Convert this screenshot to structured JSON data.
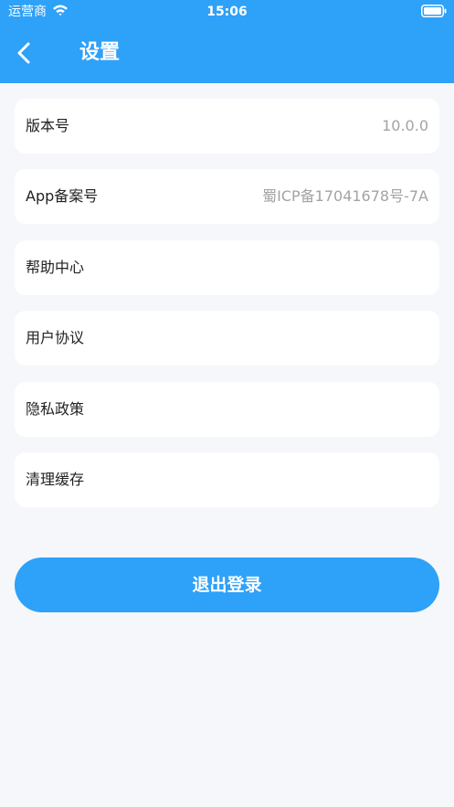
{
  "status_bar": {
    "carrier": "运营商",
    "time": "15:06",
    "wifi_icon": "wifi-icon",
    "battery_icon": "battery-icon"
  },
  "header": {
    "back_icon": "chevron-left-icon",
    "title": "设置",
    "background_color": "#2ea1f8"
  },
  "settings": {
    "items": [
      {
        "label": "版本号",
        "value": "10.0.0"
      },
      {
        "label": "App备案号",
        "value": "蜀ICP备17041678号-7A"
      },
      {
        "label": "帮助中心",
        "value": ""
      },
      {
        "label": "用户协议",
        "value": ""
      },
      {
        "label": "隐私政策",
        "value": ""
      },
      {
        "label": "清理缓存",
        "value": ""
      }
    ]
  },
  "logout": {
    "label": "退出登录",
    "color": "#2ea1f8"
  }
}
